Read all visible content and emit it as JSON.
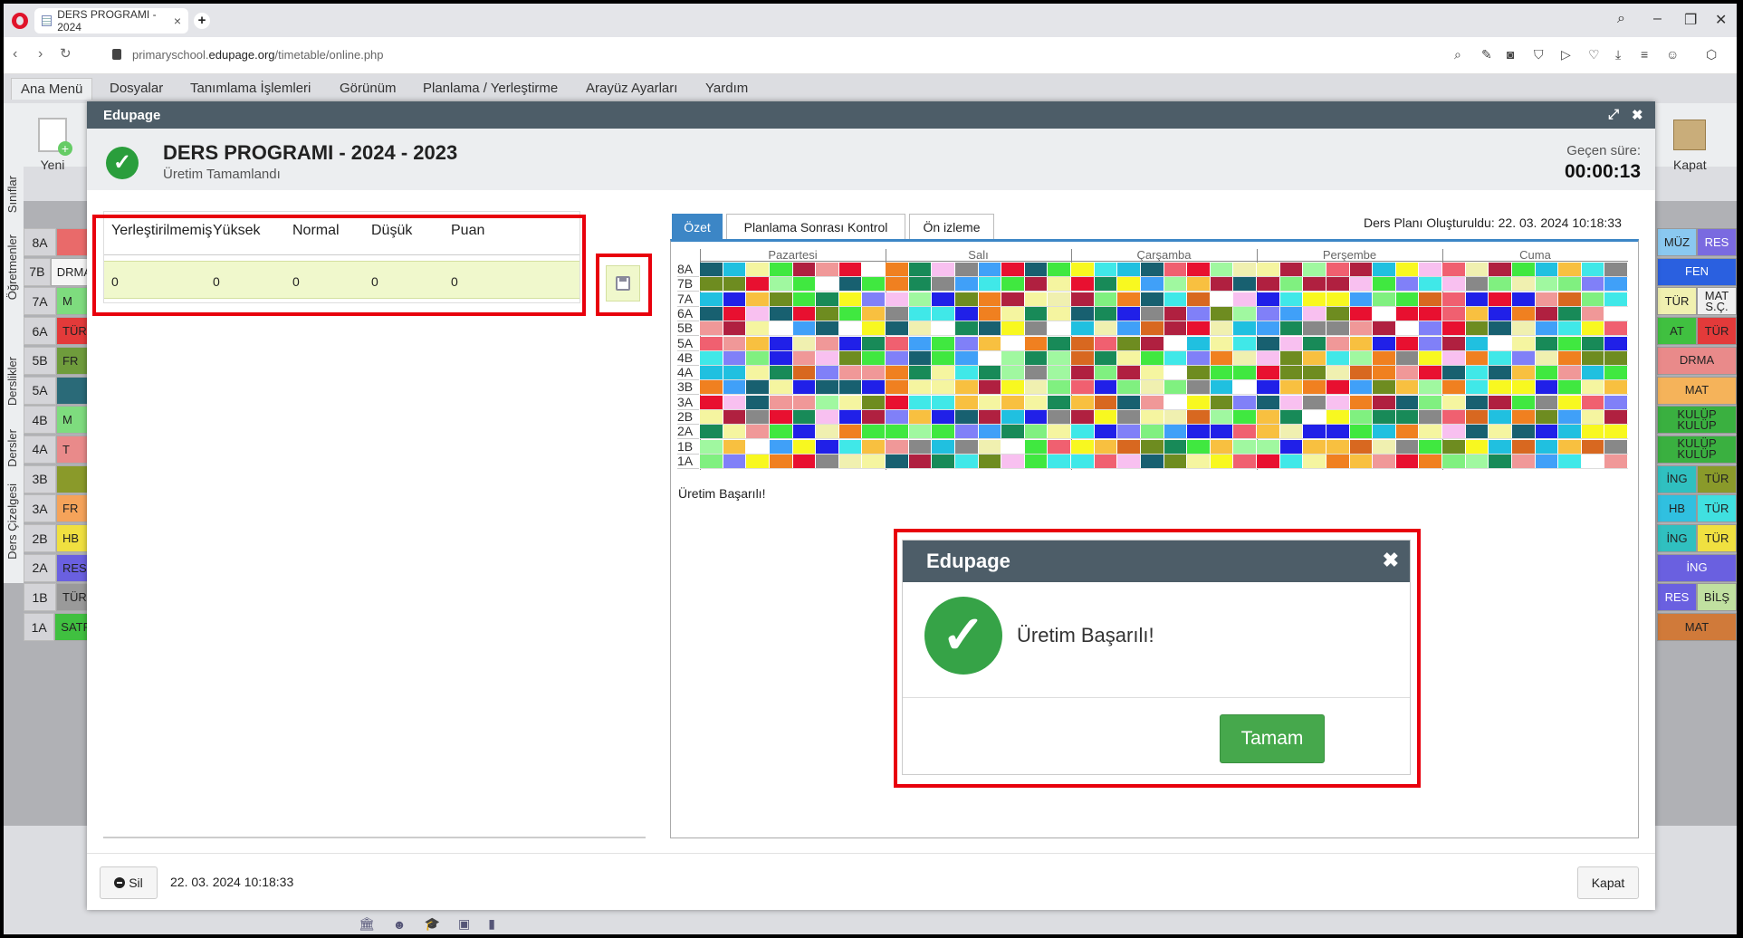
{
  "browser": {
    "tab_title": "DERS PROGRAMI - 2024",
    "url_prefix": "primaryschool.",
    "url_domain": "edupage.org",
    "url_path": "/timetable/online.php"
  },
  "menu": [
    "Ana Menü",
    "Dosyalar",
    "Tanımlama İşlemleri",
    "Görünüm",
    "Planlama / Yerleştirme",
    "Arayüz Ayarları",
    "Yardım"
  ],
  "toolbar": {
    "new_label": "Yeni",
    "close_label": "Kapat"
  },
  "side_tabs": [
    "Sınıflar",
    "Öğretmenler",
    "Derslikler",
    "Dersler",
    "Ders Çizelgesi"
  ],
  "bg_left_rows": [
    {
      "cls": "8A",
      "txt": "",
      "color": "#e96a6a"
    },
    {
      "cls": "7B",
      "txt": "DRMA",
      "color": "#f5f5f5"
    },
    {
      "cls": "7A",
      "txt": "M",
      "color": "#7edc7e"
    },
    {
      "cls": "6A",
      "txt": "TÜR",
      "color": "#e33a3a"
    },
    {
      "cls": "5B",
      "txt": "FR",
      "color": "#6f9c3c"
    },
    {
      "cls": "5A",
      "txt": "",
      "color": "#2a6a78"
    },
    {
      "cls": "4B",
      "txt": "M",
      "color": "#7edc7e"
    },
    {
      "cls": "4A",
      "txt": "T",
      "color": "#e98a8a"
    },
    {
      "cls": "3B",
      "txt": "",
      "color": "#8a9a2a"
    },
    {
      "cls": "3A",
      "txt": "FR",
      "color": "#f5a35a"
    },
    {
      "cls": "2B",
      "txt": "HB",
      "color": "#f0e040"
    },
    {
      "cls": "2A",
      "txt": "RES",
      "color": "#6a60e0"
    },
    {
      "cls": "1B",
      "txt": "TÜR",
      "color": "#9a9a9a"
    },
    {
      "cls": "1A",
      "txt": "SATR",
      "color": "#40c040"
    }
  ],
  "bg_right_rows": [
    [
      {
        "t": "MÜZ",
        "c": "#8ac8f0"
      },
      {
        "t": "RES",
        "c": "#7a6ae0"
      }
    ],
    [
      {
        "t": "FEN",
        "c": "#2a60e0"
      }
    ],
    [
      {
        "t": "TÜR",
        "c": "#f0f0b0"
      },
      {
        "t": "MAT S.Ç.",
        "c": "#f0f0f0"
      }
    ],
    [
      {
        "t": "AT",
        "c": "#40c040"
      },
      {
        "t": "TÜR",
        "c": "#e33a3a"
      }
    ],
    [
      {
        "t": "DRMA",
        "c": "#e98a8a"
      }
    ],
    [
      {
        "t": "MAT",
        "c": "#f5b35a"
      }
    ],
    [
      {
        "t": "KULÜP KULÜP",
        "c": "#3ab040"
      }
    ],
    [
      {
        "t": "KULÜP KULÜP",
        "c": "#3ab040"
      }
    ],
    [
      {
        "t": "İNG",
        "c": "#30c0c0"
      },
      {
        "t": "TÜR",
        "c": "#8a9a2a"
      }
    ],
    [
      {
        "t": "HB",
        "c": "#30c0e0"
      },
      {
        "t": "TÜR",
        "c": "#40e0e0"
      }
    ],
    [
      {
        "t": "İNG",
        "c": "#30c0c0"
      },
      {
        "t": "TÜR",
        "c": "#f0e040"
      }
    ],
    [
      {
        "t": "İNG",
        "c": "#6a60e0"
      }
    ],
    [
      {
        "t": "RES",
        "c": "#6a60e0"
      },
      {
        "t": "BİLŞ",
        "c": "#c0e0a0"
      }
    ],
    [
      {
        "t": "MAT",
        "c": "#d07a3a"
      }
    ]
  ],
  "dialog": {
    "header": "Edupage",
    "title": "DERS PROGRAMI - 2024 - 2023",
    "subtitle": "Üretim Tamamlandı",
    "elapsed_label": "Geçen süre:",
    "elapsed_value": "00:00:13",
    "stats_headers": [
      "Yerleştirilmemiş",
      "Yüksek",
      "Normal",
      "Düşük",
      "Puan"
    ],
    "stats_values": [
      "0",
      "0",
      "0",
      "0",
      "0"
    ],
    "tabs": [
      "Özet",
      "Planlama Sonrası Kontrol",
      "Ön izleme"
    ],
    "created": "Ders Planı Oluşturuldu: 22. 03. 2024 10:18:33",
    "days": [
      "Pazartesi",
      "Salı",
      "Çarşamba",
      "Perşembe",
      "Cuma"
    ],
    "classes": [
      "8A",
      "7B",
      "7A",
      "6A",
      "5B",
      "5A",
      "4B",
      "4A",
      "3B",
      "3A",
      "2B",
      "2A",
      "1B",
      "1A"
    ],
    "result_msg": "Üretim Başarılı!",
    "delete_label": "Sil",
    "footer_date": "22. 03. 2024 10:18:33",
    "close_label": "Kapat"
  },
  "modal": {
    "title": "Edupage",
    "message": "Üretim Başarılı!",
    "ok_label": "Tamam"
  },
  "colors": {
    "palette": [
      "#2020e8",
      "#e81030",
      "#f5f5a0",
      "#40e8e8",
      "#f06070",
      "#40e840",
      "#f8c0f0",
      "#f8c040",
      "#6e8c20",
      "#188a58",
      "#b02040",
      "#186070",
      "#f09898",
      "#20c0e0",
      "#f08020",
      "#40a0f8",
      "#f8f820",
      "#8080f8",
      "#888888",
      "#d86820",
      "#80f080",
      "#ffffff",
      "#a0f8a0",
      "#f0f0b0"
    ],
    "accent": "#3c86c6",
    "highlight": "#e8000c",
    "success": "#36a347"
  }
}
